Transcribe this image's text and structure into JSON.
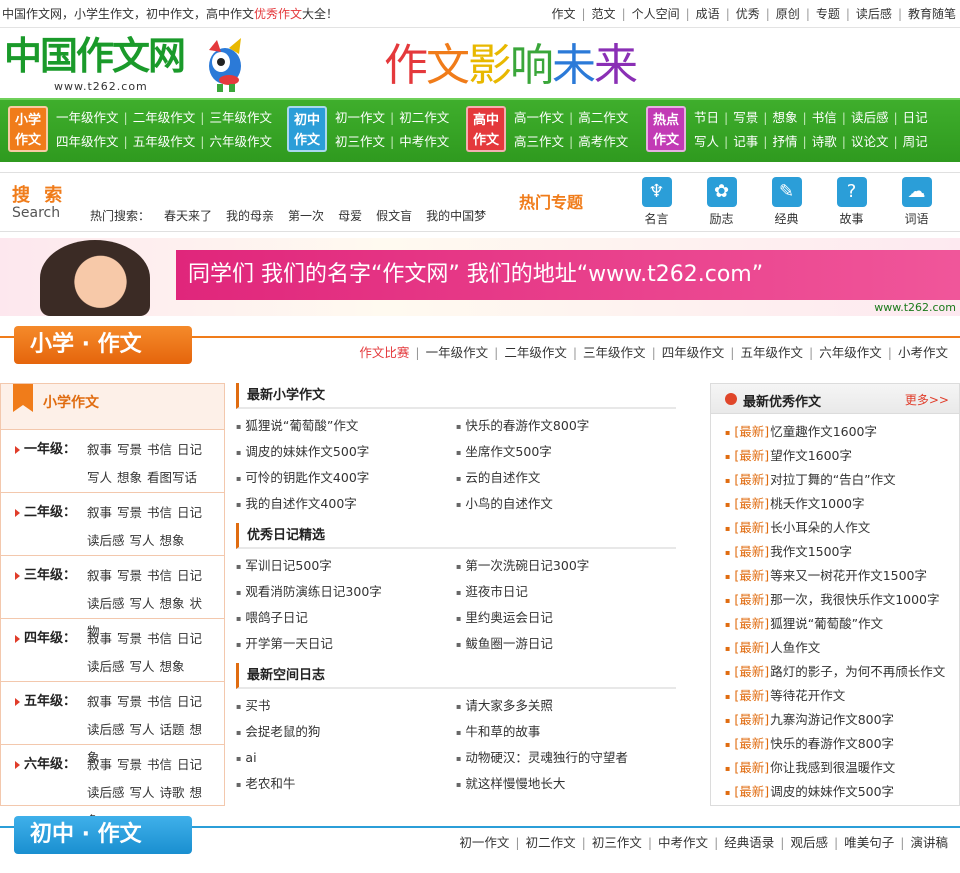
{
  "topbar": {
    "left_pre": "中国作文网，小学生作文，初中作文，高中作文",
    "left_red": "优秀作文",
    "left_post": "大全！",
    "links": [
      "作文",
      "范文",
      "个人空间",
      "成语",
      "优秀",
      "原创",
      "专题",
      "读后感",
      "教育随笔"
    ]
  },
  "logo": {
    "text": "中国作文网",
    "url": "www.t262.com"
  },
  "slogan": {
    "chars": [
      "作",
      "文",
      "影",
      "响",
      "未",
      "来"
    ],
    "colors": [
      "#e4393c",
      "#f07c1a",
      "#e8b800",
      "#3aa63a",
      "#2b7ad8",
      "#8a2fb5"
    ]
  },
  "nav": {
    "groups": [
      {
        "badge": "小学\n作文",
        "color": "#f07c1a",
        "row1": [
          "一年级作文",
          "二年级作文",
          "三年级作文"
        ],
        "row2": [
          "四年级作文",
          "五年级作文",
          "六年级作文"
        ]
      },
      {
        "badge": "初中\n作文",
        "color": "#2b9ed8",
        "row1": [
          "初一作文",
          "初二作文"
        ],
        "row2": [
          "初三作文",
          "中考作文"
        ]
      },
      {
        "badge": "高中\n作文",
        "color": "#e4393c",
        "row1": [
          "高一作文",
          "高二作文"
        ],
        "row2": [
          "高三作文",
          "高考作文"
        ]
      },
      {
        "badge": "热点\n作文",
        "color": "#c23bb5",
        "row1": [
          "节日",
          "写景",
          "想象",
          "书信",
          "读后感",
          "日记"
        ],
        "row2": [
          "写人",
          "记事",
          "抒情",
          "诗歌",
          "议论文",
          "周记"
        ]
      }
    ]
  },
  "search": {
    "title": "搜 索",
    "en": "Search",
    "hot_label": "热门搜索：",
    "hot": [
      "春天来了",
      "我的母亲",
      "第一次",
      "母爱",
      "假文盲",
      "我的中国梦"
    ],
    "topic_title": "热门专题",
    "topics": [
      {
        "label": "名言",
        "icon": "swan-icon"
      },
      {
        "label": "励志",
        "icon": "flower-icon"
      },
      {
        "label": "经典",
        "icon": "book-icon"
      },
      {
        "label": "故事",
        "icon": "question-icon"
      },
      {
        "label": "词语",
        "icon": "cloud-icon"
      }
    ]
  },
  "banner": {
    "text": "同学们 我们的名字“作文网”  我们的地址“www.t262.com”",
    "small": "www.t262.com"
  },
  "primary": {
    "title": "小学 · 作文",
    "sublinks_red": "作文比赛",
    "sublinks": [
      "一年级作文",
      "二年级作文",
      "三年级作文",
      "四年级作文",
      "五年级作文",
      "六年级作文",
      "小考作文"
    ],
    "left_title": "小学作文",
    "grades": [
      {
        "name": "一年级：",
        "items": [
          "叙事",
          "写景",
          "书信",
          "日记",
          "写人",
          "想象",
          "看图写话"
        ]
      },
      {
        "name": "二年级：",
        "items": [
          "叙事",
          "写景",
          "书信",
          "日记",
          "读后感",
          "写人",
          "想象"
        ]
      },
      {
        "name": "三年级：",
        "items": [
          "叙事",
          "写景",
          "书信",
          "日记",
          "读后感",
          "写人",
          "想象",
          "状物"
        ]
      },
      {
        "name": "四年级：",
        "items": [
          "叙事",
          "写景",
          "书信",
          "日记",
          "读后感",
          "写人",
          "想象"
        ]
      },
      {
        "name": "五年级：",
        "items": [
          "叙事",
          "写景",
          "书信",
          "日记",
          "读后感",
          "写人",
          "话题",
          "想象"
        ]
      },
      {
        "name": "六年级：",
        "items": [
          "叙事",
          "写景",
          "书信",
          "日记",
          "读后感",
          "写人",
          "诗歌",
          "想象"
        ]
      }
    ],
    "mid_sections": [
      {
        "title": "最新小学作文",
        "items": [
          "狐狸说“葡萄酸”作文",
          "快乐的春游作文800字",
          "调皮的妹妹作文500字",
          "坐席作文500字",
          "可怜的钥匙作文400字",
          "云的自述作文",
          "我的自述作文400字",
          "小鸟的自述作文"
        ]
      },
      {
        "title": "优秀日记精选",
        "items": [
          "军训日记500字",
          "第一次洗碗日记300字",
          "观看消防演练日记300字",
          "逛夜市日记",
          "喂鸽子日记",
          "里约奥运会日记",
          "开学第一天日记",
          "鲅鱼圈一游日记"
        ]
      },
      {
        "title": "最新空间日志",
        "items": [
          "买书",
          "请大家多多关照",
          "会捉老鼠的狗",
          "牛和草的故事",
          "ai",
          "动物硬汉：灵魂独行的守望者",
          "老农和牛",
          "就这样慢慢地长大"
        ]
      }
    ],
    "right_title": "最新优秀作文",
    "right_more": "更多>>",
    "right_tag": "[最新]",
    "right_items": [
      "忆童趣作文1600字",
      "望作文1600字",
      "对拉丁舞的“告白”作文",
      "桃夭作文1000字",
      "长小耳朵的人作文",
      "我作文1500字",
      "等来又一树花开作文1500字",
      "那一次，我很快乐作文1000字",
      "狐狸说“葡萄酸”作文",
      "人鱼作文",
      "路灯的影子，为何不再颀长作文",
      "等待花开作文",
      "九寨沟游记作文800字",
      "快乐的春游作文800字",
      "你让我感到很温暖作文",
      "调皮的妹妹作文500字"
    ]
  },
  "junior": {
    "title": "初中 · 作文",
    "sublinks": [
      "初一作文",
      "初二作文",
      "初三作文",
      "中考作文",
      "经典语录",
      "观后感",
      "唯美句子",
      "演讲稿"
    ]
  }
}
